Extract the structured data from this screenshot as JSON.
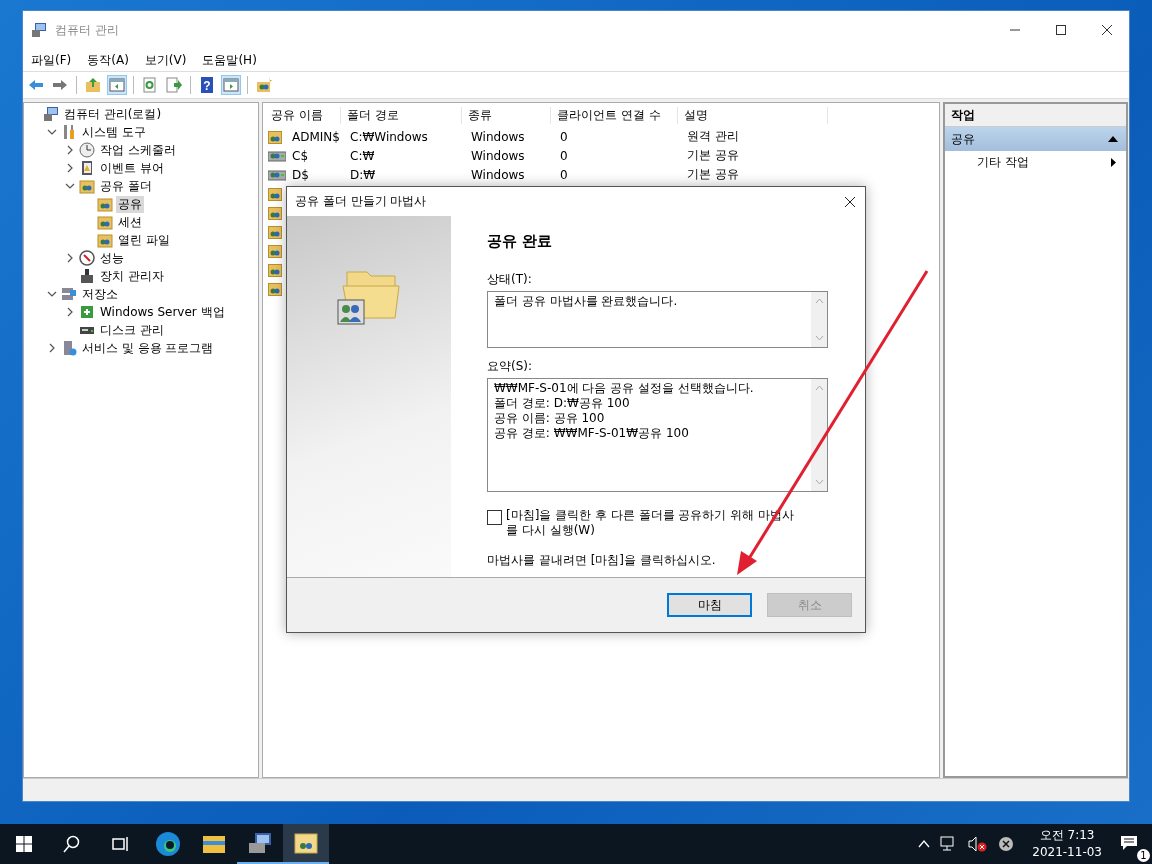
{
  "window": {
    "title": "컴퓨터 관리"
  },
  "menu": [
    "파일(F)",
    "동작(A)",
    "보기(V)",
    "도움말(H)"
  ],
  "toolbar": [
    {
      "kind": "back",
      "pressed": false
    },
    {
      "kind": "forward",
      "pressed": false
    },
    {
      "kind": "sep"
    },
    {
      "kind": "up",
      "pressed": false
    },
    {
      "kind": "pane",
      "pressed": true
    },
    {
      "kind": "sep"
    },
    {
      "kind": "refresh",
      "pressed": false
    },
    {
      "kind": "export",
      "pressed": false
    },
    {
      "kind": "sep"
    },
    {
      "kind": "help",
      "glyph": "?",
      "pressed": false
    },
    {
      "kind": "actionpane",
      "pressed": true
    },
    {
      "kind": "sep"
    },
    {
      "kind": "newshare",
      "pressed": false
    }
  ],
  "tree": [
    {
      "label": "컴퓨터 관리(로컬)",
      "kind": "computer",
      "selected": false,
      "children": [
        {
          "label": "시스템 도구",
          "kind": "tools",
          "expanded": true,
          "selected": false,
          "children": [
            {
              "label": "작업 스케줄러",
              "kind": "clock",
              "expanded": false,
              "selected": false
            },
            {
              "label": "이벤트 뷰어",
              "kind": "event",
              "expanded": false,
              "selected": false
            },
            {
              "label": "공유 폴더",
              "kind": "share",
              "expanded": true,
              "selected": false,
              "children": [
                {
                  "label": "공유",
                  "kind": "share",
                  "selected": true
                },
                {
                  "label": "세션",
                  "kind": "share",
                  "selected": false
                },
                {
                  "label": "열린 파일",
                  "kind": "share",
                  "selected": false
                }
              ]
            },
            {
              "label": "성능",
              "kind": "perf",
              "expanded": false,
              "selected": false
            },
            {
              "label": "장치 관리자",
              "kind": "device",
              "selected": false
            }
          ]
        },
        {
          "label": "저장소",
          "kind": "storage",
          "expanded": true,
          "selected": false,
          "children": [
            {
              "label": "Windows Server 백업",
              "kind": "backup",
              "expanded": false,
              "selected": false
            },
            {
              "label": "디스크 관리",
              "kind": "disk",
              "selected": false
            }
          ]
        },
        {
          "label": "서비스 및 응용 프로그램",
          "kind": "services",
          "expanded": false,
          "selected": false
        }
      ]
    }
  ],
  "table": {
    "columns": [
      "공유 이름",
      "폴더 경로",
      "종류",
      "클라이언트 연결 수",
      "설명"
    ],
    "rows": [
      {
        "kind": "folder",
        "cells": [
          "ADMIN$",
          "C:₩Windows",
          "Windows",
          "0",
          "원격 관리"
        ]
      },
      {
        "kind": "drive",
        "cells": [
          "C$",
          "C:₩",
          "Windows",
          "0",
          "기본 공유"
        ]
      },
      {
        "kind": "drive",
        "cells": [
          "D$",
          "D:₩",
          "Windows",
          "0",
          "기본 공유"
        ]
      },
      {
        "kind": "folder",
        "cells": []
      },
      {
        "kind": "folder",
        "cells": []
      },
      {
        "kind": "folder",
        "cells": []
      },
      {
        "kind": "folder",
        "cells": []
      },
      {
        "kind": "folder",
        "cells": []
      },
      {
        "kind": "folder",
        "cells": []
      }
    ]
  },
  "actions": {
    "title": "작업",
    "section": {
      "label": "공유",
      "expanded": true
    },
    "items": [
      {
        "label": "기타 작업"
      }
    ]
  },
  "dialog": {
    "title": "공유 폴더 만들기 마법사",
    "heading": "공유 완료",
    "status_label": "상태(T):",
    "status_text": "폴더 공유 마법사를 완료했습니다.",
    "summary_label": "요약(S):",
    "summary_lines": [
      "₩₩MF-S-01에 다음 공유 설정을 선택했습니다.",
      "폴더 경로: D:₩공유 100",
      "공유 이름: 공유 100",
      "공유 경로: ₩₩MF-S-01₩공유 100"
    ],
    "rerun": {
      "label": "[마침]을 클릭한 후 다른 폴더를 공유하기 위해 마법사를 다시 실행(W)",
      "checked": false
    },
    "hint": "마법사를 끝내려면 [마침]을 클릭하십시오.",
    "buttons": [
      {
        "label": "마침",
        "disabled": false,
        "default": true
      },
      {
        "label": "취소",
        "disabled": true,
        "default": false
      }
    ]
  },
  "taskbar": {
    "apps": [
      {
        "kind": "edge",
        "active": false
      },
      {
        "kind": "explorer",
        "active": false
      },
      {
        "kind": "compmgmt",
        "active": true
      },
      {
        "kind": "sharefolder",
        "active": true
      }
    ],
    "time": "오전 7:13",
    "date": "2021-11-03",
    "notifications": "1"
  }
}
